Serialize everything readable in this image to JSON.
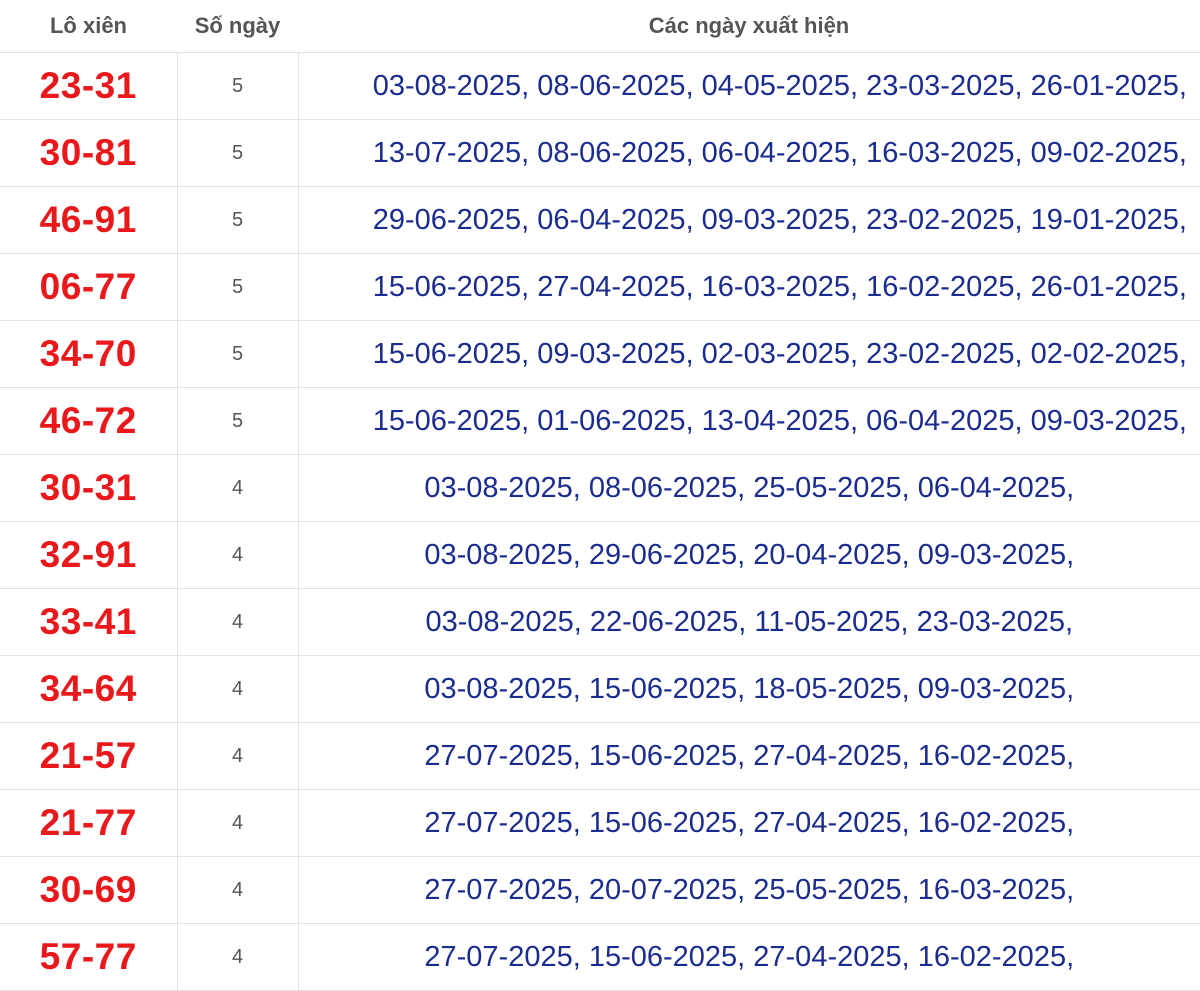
{
  "headers": {
    "pair": "Lô xiên",
    "count": "Số ngày",
    "dates": "Các ngày xuất hiện"
  },
  "rows": [
    {
      "pair": "23-31",
      "count": "5",
      "dates": "03-08-2025, 08-06-2025, 04-05-2025, 23-03-2025, 26-01-2025,"
    },
    {
      "pair": "30-81",
      "count": "5",
      "dates": "13-07-2025, 08-06-2025, 06-04-2025, 16-03-2025, 09-02-2025,"
    },
    {
      "pair": "46-91",
      "count": "5",
      "dates": "29-06-2025, 06-04-2025, 09-03-2025, 23-02-2025, 19-01-2025,"
    },
    {
      "pair": "06-77",
      "count": "5",
      "dates": "15-06-2025, 27-04-2025, 16-03-2025, 16-02-2025, 26-01-2025,"
    },
    {
      "pair": "34-70",
      "count": "5",
      "dates": "15-06-2025, 09-03-2025, 02-03-2025, 23-02-2025, 02-02-2025,"
    },
    {
      "pair": "46-72",
      "count": "5",
      "dates": "15-06-2025, 01-06-2025, 13-04-2025, 06-04-2025, 09-03-2025,"
    },
    {
      "pair": "30-31",
      "count": "4",
      "dates": "03-08-2025, 08-06-2025, 25-05-2025, 06-04-2025,"
    },
    {
      "pair": "32-91",
      "count": "4",
      "dates": "03-08-2025, 29-06-2025, 20-04-2025, 09-03-2025,"
    },
    {
      "pair": "33-41",
      "count": "4",
      "dates": "03-08-2025, 22-06-2025, 11-05-2025, 23-03-2025,"
    },
    {
      "pair": "34-64",
      "count": "4",
      "dates": "03-08-2025, 15-06-2025, 18-05-2025, 09-03-2025,"
    },
    {
      "pair": "21-57",
      "count": "4",
      "dates": "27-07-2025, 15-06-2025, 27-04-2025, 16-02-2025,"
    },
    {
      "pair": "21-77",
      "count": "4",
      "dates": "27-07-2025, 15-06-2025, 27-04-2025, 16-02-2025,"
    },
    {
      "pair": "30-69",
      "count": "4",
      "dates": "27-07-2025, 20-07-2025, 25-05-2025, 16-03-2025,"
    },
    {
      "pair": "57-77",
      "count": "4",
      "dates": "27-07-2025, 15-06-2025, 27-04-2025, 16-02-2025,"
    }
  ],
  "colors": {
    "pair": "#e8181b",
    "dates": "#1b2c8f",
    "header": "#555555",
    "border": "#e2e2e2"
  }
}
